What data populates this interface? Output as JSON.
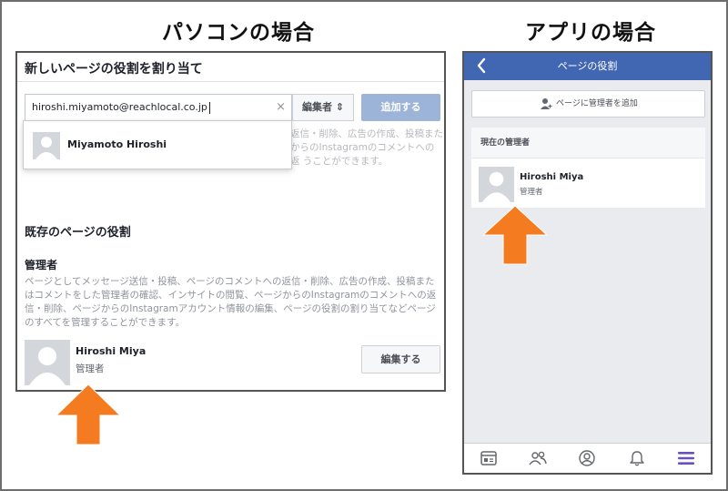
{
  "titles": {
    "pc": "パソコンの場合",
    "app": "アプリの場合"
  },
  "pc": {
    "heading": "新しいページの役割を割り当て",
    "input_value": "hiroshi.miyamoto@reachlocal.co.jp",
    "clear_glyph": "×",
    "role_select": "編集者 ⇕",
    "add_button": "追加する",
    "suggestion_name": "Miyamoto Hiroshi",
    "faded_text": "返信・削除、広告の作成、投稿また からのInstagramのコメントへの返 うことができます。",
    "existing_heading": "既存のページの役割",
    "admin_heading": "管理者",
    "admin_description": "ページとしてメッセージ送信・投稿、ページのコメントへの返信・削除、広告の作成、投稿またはコメントをした管理者の確認、インサイトの閲覧、ページからのInstagramのコメントへの返信・削除、ページからのInstagramアカウント情報の編集、ページの役割の割り当てなどページのすべてを管理することができます。",
    "user_name": "Hiroshi Miya",
    "user_role": "管理者",
    "edit_button": "編集する"
  },
  "app": {
    "header_title": "ページの役割",
    "add_admin_label": "ページに管理者を追加",
    "current_admins_heading": "現在の管理者",
    "user_name": "Hiroshi Miya",
    "user_role": "管理者",
    "tabs": [
      "pages-icon",
      "friends-icon",
      "profile-icon",
      "notifications-icon",
      "menu-icon"
    ]
  },
  "colors": {
    "facebook_blue": "#4267b2",
    "add_button_disabled": "#9cb4d8",
    "arrow_orange": "#f47b20",
    "menu_active": "#6b4fbb"
  }
}
